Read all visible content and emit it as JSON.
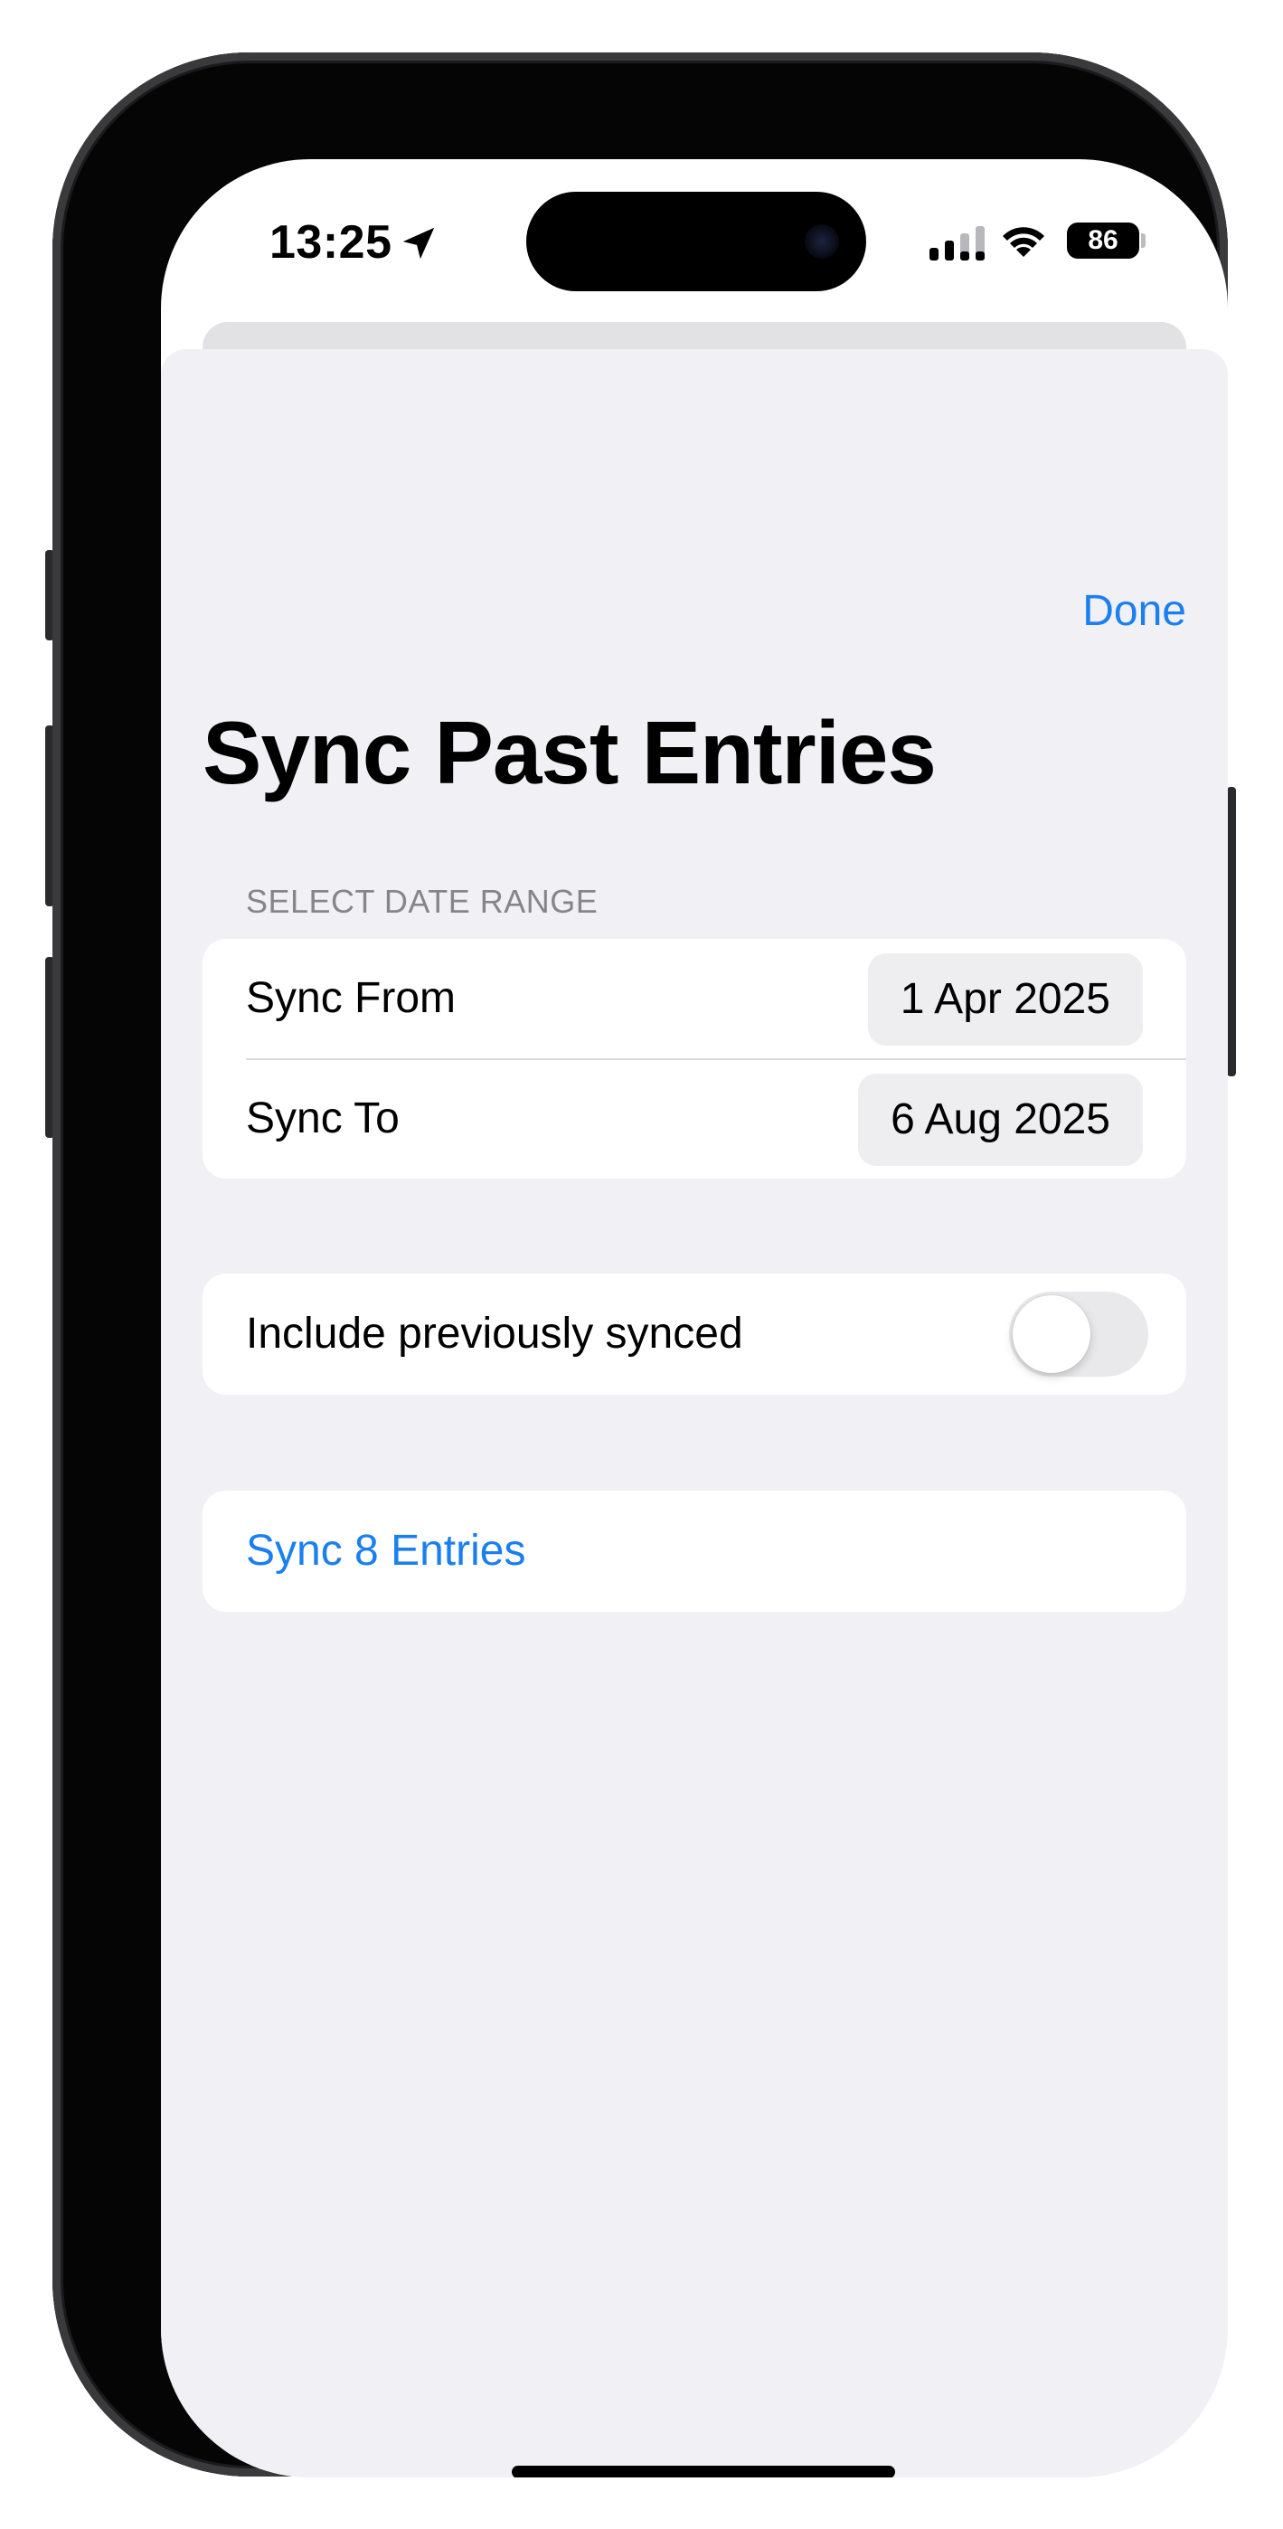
{
  "status_bar": {
    "time": "13:25",
    "battery": "86",
    "icons": [
      "location-arrow-icon",
      "cellular-signal-icon",
      "wifi-icon",
      "battery-icon"
    ]
  },
  "sheet": {
    "done_label": "Done",
    "title": "Sync Past Entries"
  },
  "date_range": {
    "header": "SELECT DATE RANGE",
    "from_label": "Sync From",
    "from_value": "1 Apr 2025",
    "to_label": "Sync To",
    "to_value": "6 Aug 2025"
  },
  "options": {
    "include_label": "Include previously synced",
    "include_enabled": false
  },
  "action": {
    "label": "Sync 8 Entries"
  },
  "colors": {
    "accent": "#1a7ff0",
    "background": "#f1f1f5",
    "card": "#ffffff"
  }
}
